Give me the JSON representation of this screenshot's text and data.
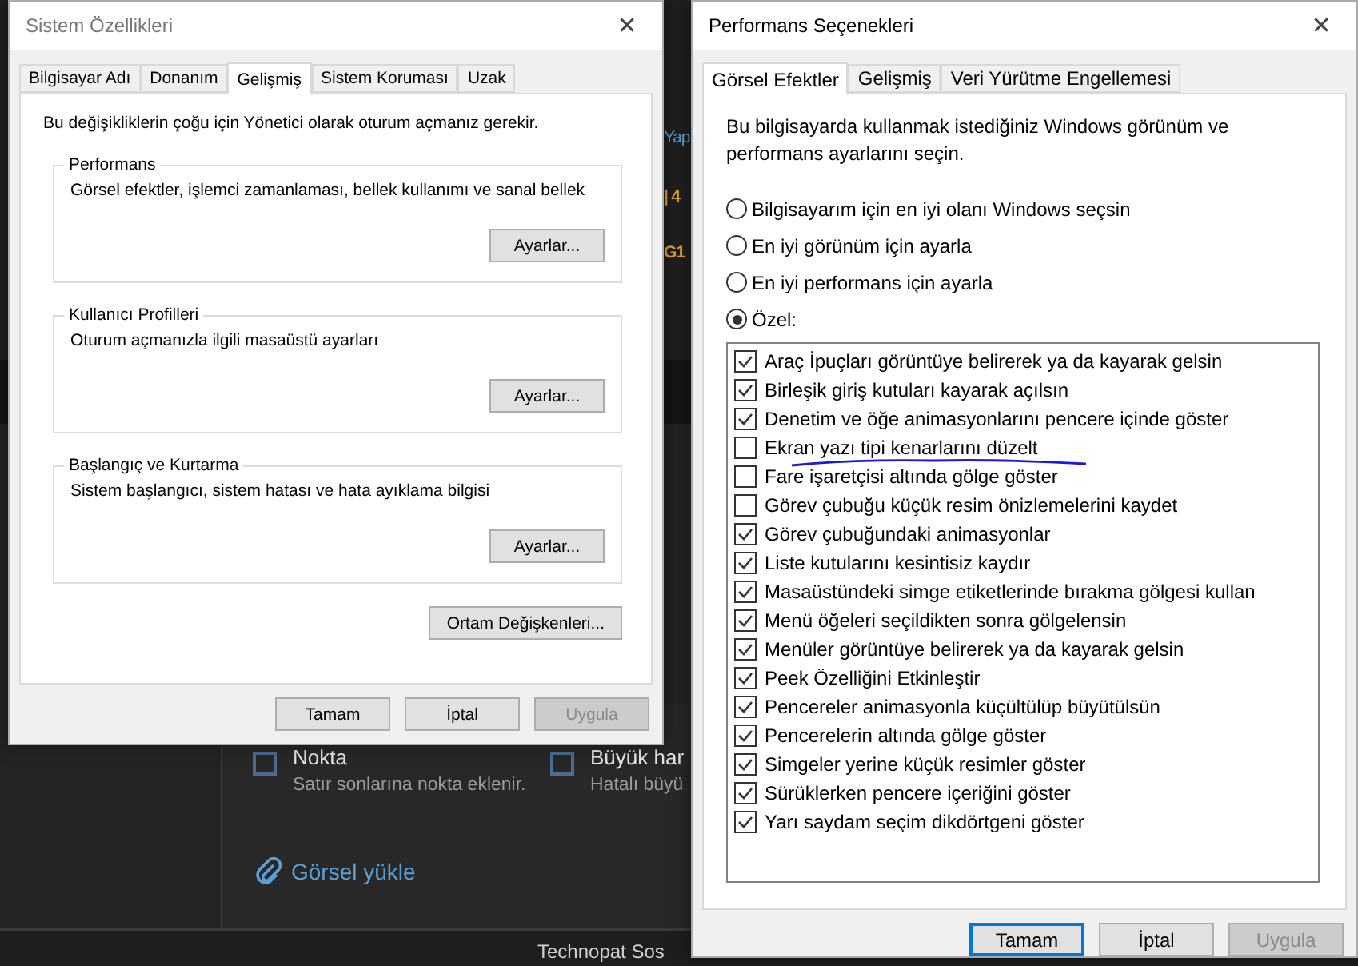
{
  "background_page": {
    "fragments": [
      {
        "text": "Yap",
        "kind": "link"
      },
      {
        "text": "| 4",
        "kind": "accent"
      },
      {
        "text": "G1",
        "kind": "accent"
      }
    ],
    "options": [
      {
        "label": "Nokta",
        "description": "Satır sonlarına nokta eklenir.",
        "checked": false
      },
      {
        "label": "Büyük har",
        "description": "Hatalı büyü",
        "checked": false
      }
    ],
    "upload_link": "Görsel yükle",
    "footer": "Technopat Sos"
  },
  "system_properties": {
    "title": "Sistem Özellikleri",
    "close": "✕",
    "tabs": [
      {
        "label": "Bilgisayar Adı",
        "selected": false
      },
      {
        "label": "Donanım",
        "selected": false
      },
      {
        "label": "Gelişmiş",
        "selected": true
      },
      {
        "label": "Sistem Koruması",
        "selected": false
      },
      {
        "label": "Uzak",
        "selected": false
      }
    ],
    "notice": "Bu değişikliklerin çoğu için Yönetici olarak oturum açmanız gerekir.",
    "groups": [
      {
        "title": "Performans",
        "description": "Görsel efektler, işlemci zamanlaması, bellek kullanımı ve sanal bellek",
        "button": "Ayarlar..."
      },
      {
        "title": "Kullanıcı Profilleri",
        "description": "Oturum açmanızla ilgili masaüstü ayarları",
        "button": "Ayarlar..."
      },
      {
        "title": "Başlangıç ve Kurtarma",
        "description": "Sistem başlangıcı, sistem hatası ve hata ayıklama bilgisi",
        "button": "Ayarlar..."
      }
    ],
    "env_button": "Ortam Değişkenleri...",
    "buttons": [
      {
        "label": "Tamam",
        "disabled": false,
        "focused": false
      },
      {
        "label": "İptal",
        "disabled": false,
        "focused": false
      },
      {
        "label": "Uygula",
        "disabled": true,
        "focused": false
      }
    ]
  },
  "performance_options": {
    "title": "Performans Seçenekleri",
    "close": "✕",
    "tabs": [
      {
        "label": "Görsel Efektler",
        "selected": true
      },
      {
        "label": "Gelişmiş",
        "selected": false
      },
      {
        "label": "Veri Yürütme Engellemesi",
        "selected": false
      }
    ],
    "intro": "Bu bilgisayarda kullanmak istediğiniz Windows görünüm ve performans ayarlarını seçin.",
    "radios": [
      {
        "label": "Bilgisayarım için en iyi olanı Windows seçsin",
        "selected": false
      },
      {
        "label": "En iyi görünüm için ayarla",
        "selected": false
      },
      {
        "label": "En iyi performans için ayarla",
        "selected": false
      },
      {
        "label": "Özel:",
        "selected": true
      }
    ],
    "effects": [
      {
        "label": "Araç İpuçları görüntüye belirerek ya da kayarak gelsin",
        "checked": true
      },
      {
        "label": "Birleşik giriş kutuları kayarak açılsın",
        "checked": true
      },
      {
        "label": "Denetim ve öğe animasyonlarını pencere içinde göster",
        "checked": true
      },
      {
        "label": "Ekran yazı tipi kenarlarını düzelt",
        "checked": false,
        "underlined": true
      },
      {
        "label": "Fare işaretçisi altında gölge göster",
        "checked": false
      },
      {
        "label": "Görev çubuğu küçük resim önizlemelerini kaydet",
        "checked": false
      },
      {
        "label": "Görev çubuğundaki animasyonlar",
        "checked": true
      },
      {
        "label": "Liste kutularını kesintisiz kaydır",
        "checked": true
      },
      {
        "label": "Masaüstündeki simge etiketlerinde bırakma gölgesi kullan",
        "checked": true
      },
      {
        "label": "Menü öğeleri seçildikten sonra gölgelensin",
        "checked": true
      },
      {
        "label": "Menüler görüntüye belirerek ya da kayarak gelsin",
        "checked": true
      },
      {
        "label": "Peek Özelliğini Etkinleştir",
        "checked": true
      },
      {
        "label": "Pencereler animasyonla küçültülüp büyütülsün",
        "checked": true
      },
      {
        "label": "Pencerelerin altında gölge göster",
        "checked": true
      },
      {
        "label": "Simgeler yerine küçük resimler göster",
        "checked": true
      },
      {
        "label": "Sürüklerken pencere içeriğini göster",
        "checked": true
      },
      {
        "label": "Yarı saydam seçim dikdörtgeni göster",
        "checked": true
      }
    ],
    "buttons": [
      {
        "label": "Tamam",
        "disabled": false,
        "focused": true
      },
      {
        "label": "İptal",
        "disabled": false,
        "focused": false
      },
      {
        "label": "Uygula",
        "disabled": true,
        "focused": false
      }
    ]
  }
}
